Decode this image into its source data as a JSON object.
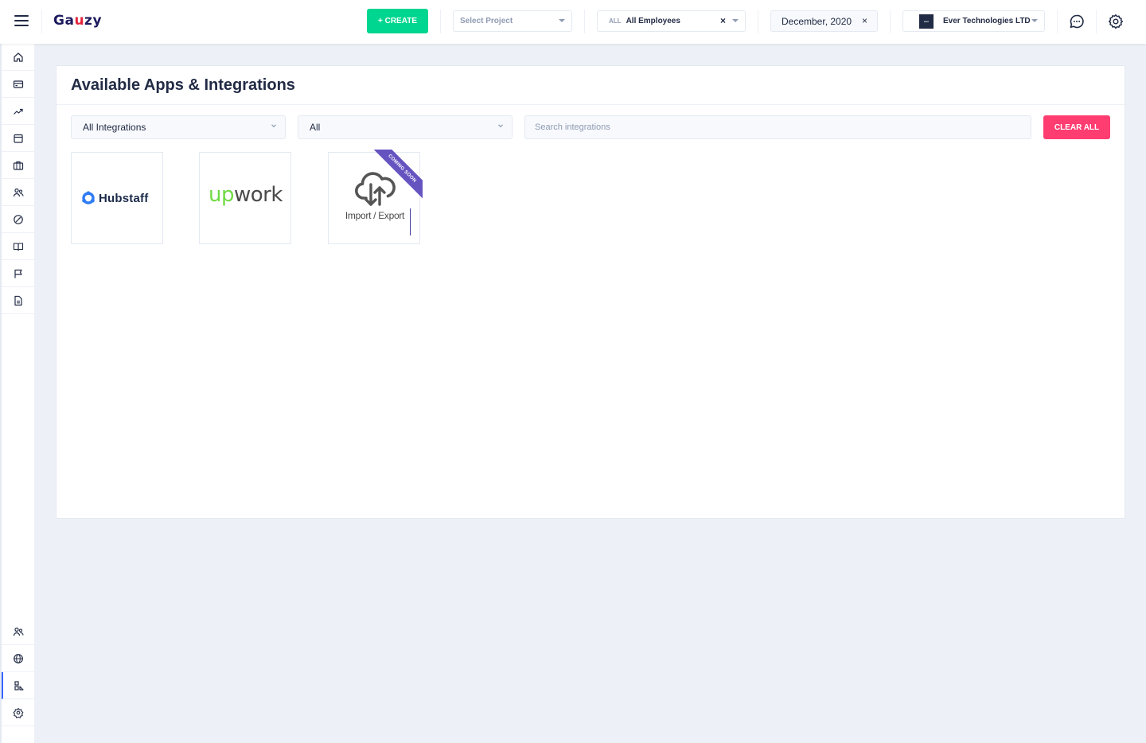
{
  "header": {
    "logo_text_a": "Ga",
    "logo_text_b": "u",
    "logo_text_c": "zy",
    "create_label": "+ CREATE",
    "project_placeholder": "Select Project",
    "employee_tag": "ALL",
    "employee_value": "All Employees",
    "date_value": "December, 2020",
    "org_logo_text": "ever",
    "org_value": "Ever Technologies LTD"
  },
  "page": {
    "title": "Available Apps & Integrations"
  },
  "filters": {
    "integration_type": "All Integrations",
    "category": "All",
    "search_placeholder": "Search integrations",
    "clear_label": "CLEAR ALL"
  },
  "integrations": [
    {
      "name": "Hubstaff"
    },
    {
      "name": "upwork",
      "name_accent": "up",
      "name_rest": "work"
    },
    {
      "name": "Import / Export",
      "badge": "COMING SOON"
    }
  ],
  "colors": {
    "accent_green": "#00d68f",
    "danger_pink": "#ff3d71",
    "active_blue": "#3366ff",
    "ribbon_purple": "#6554c0",
    "upwork_green": "#6fda44"
  },
  "sidebar_icons": [
    "home-icon",
    "credit-card-icon",
    "trending-up-icon",
    "calendar-icon",
    "briefcase-icon",
    "people-icon",
    "speedometer-icon",
    "book-icon",
    "flag-icon",
    "file-text-icon",
    "people-outline-icon",
    "globe-icon",
    "integrations-icon",
    "settings-flower-icon"
  ]
}
